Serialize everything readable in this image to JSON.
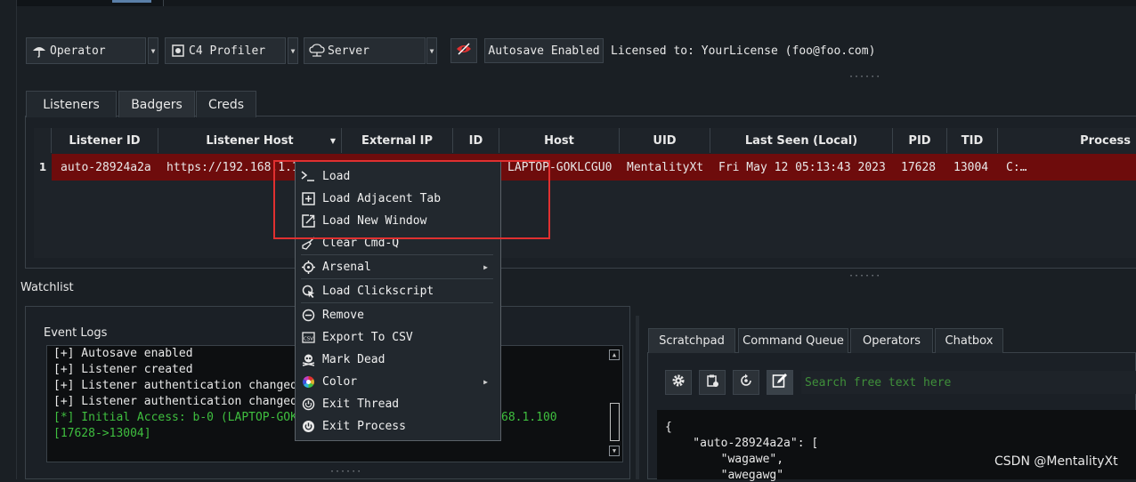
{
  "toolbar": {
    "operator_label": "Operator",
    "profiler_label": "C4 Profiler",
    "server_label": "Server",
    "autosave_label": "Autosave Enabled",
    "license_text": "Licensed to: YourLicense (foo@foo.com)"
  },
  "tabs": [
    "Listeners",
    "Badgers",
    "Creds"
  ],
  "active_tab": "Badgers",
  "table": {
    "headers": [
      "Listener ID",
      "Listener Host",
      "External IP",
      "ID",
      "Host",
      "UID",
      "Last Seen (Local)",
      "PID",
      "TID",
      "Process"
    ],
    "sort_indicator": "▼",
    "rows": [
      {
        "index": "1",
        "listener_id": "auto-28924a2a",
        "listener_host": "https://192.168.1.1",
        "external_ip": "",
        "id": "",
        "host": "LAPTOP-GOKLCGU0",
        "uid": "MentalityXt",
        "last_seen": "Fri May 12 05:13:43 2023",
        "pid": "17628",
        "tid": "13004",
        "process": "C:…"
      }
    ],
    "selected_row_color": "#6e0c0c"
  },
  "watchlist_label": "Watchlist",
  "event_logs": {
    "title": "Event Logs",
    "lines": [
      "[+] Autosave enabled",
      "[+] Listener created",
      "[+] Listener authentication changed",
      "[+] Listener authentication changed",
      "[*] Initial Access: b-0 (LAPTOP-GOK",
      "[17628->13004]"
    ],
    "access_tail": "68.1.100",
    "access_color": "#3fbf3f"
  },
  "context_menu": {
    "items": [
      {
        "label": "Load",
        "icon": "terminal-icon"
      },
      {
        "label": "Load Adjacent Tab",
        "icon": "tab-add-icon"
      },
      {
        "label": "Load New Window",
        "icon": "new-window-icon"
      },
      {
        "label": "Clear Cmd-Q",
        "icon": "broom-icon"
      },
      {
        "label": "Arsenal",
        "icon": "crosshair-icon",
        "submenu": true
      },
      {
        "label": "Load Clickscript",
        "icon": "click-icon"
      },
      {
        "label": "Remove",
        "icon": "remove-icon"
      },
      {
        "label": "Export To CSV",
        "icon": "csv-icon"
      },
      {
        "label": "Mark Dead",
        "icon": "skull-icon"
      },
      {
        "label": "Color",
        "icon": "color-wheel-icon",
        "submenu": true
      },
      {
        "label": "Exit Thread",
        "icon": "exit-thread-icon"
      },
      {
        "label": "Exit Process",
        "icon": "power-icon"
      }
    ],
    "highlight_color": "#e03030"
  },
  "right_panel": {
    "tabs": [
      "Scratchpad",
      "Command Queue",
      "Operators",
      "Chatbox"
    ],
    "active_tab": "Scratchpad",
    "search_placeholder": "Search free text here",
    "json_lines": [
      "{",
      "    \"auto-28924a2a\": [",
      "        \"wagawe\",",
      "        \"awegawg\""
    ]
  },
  "watermark": "CSDN @MentalityXt"
}
